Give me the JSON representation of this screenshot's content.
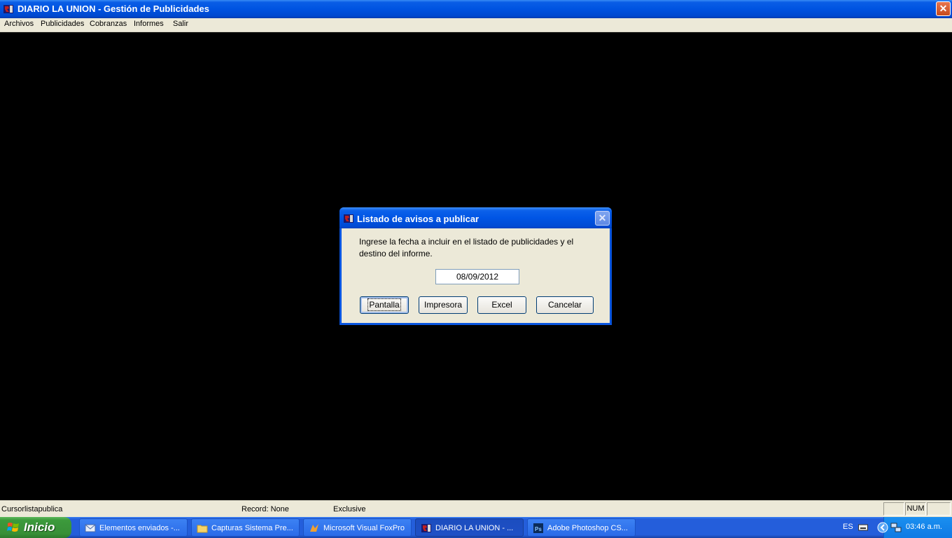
{
  "window": {
    "title": "DIARIO LA UNION - Gestión de Publicidades",
    "close_symbol": "✕"
  },
  "menubar": {
    "items": [
      "Archivos",
      "Publicidades",
      "Cobranzas",
      "Informes",
      "Salir"
    ]
  },
  "dialog": {
    "title": "Listado de avisos a publicar",
    "close_symbol": "✕",
    "message": "Ingrese la fecha a incluir en el listado de publicidades y el destino del informe.",
    "date_value": "08/09/2012",
    "buttons": [
      "Pantalla",
      "Impresora",
      "Excel",
      "Cancelar"
    ]
  },
  "statusbar": {
    "cursor": "Cursorlistapublica",
    "record": "Record: None",
    "mode": "Exclusive",
    "num": "NUM"
  },
  "taskbar": {
    "start_label": "Inicio",
    "items": [
      "Elementos enviados -...",
      "Capturas Sistema Pre...",
      "Microsoft Visual FoxPro",
      "DIARIO LA UNION - ...",
      "Adobe Photoshop CS..."
    ],
    "language": "ES",
    "clock": "03:46 a.m."
  },
  "colors": {
    "title_blue": "#0053e1",
    "face": "#ece9d8",
    "start_green": "#378f37"
  }
}
